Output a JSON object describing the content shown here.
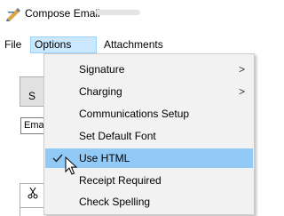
{
  "window": {
    "title": "Compose Email",
    "icon": "compose-email-icon"
  },
  "menubar": {
    "file": "File",
    "options": "Options",
    "attachments": "Attachments"
  },
  "background": {
    "button_fragment": "S",
    "combo_fragment": "Ema",
    "cut_icon": "scissors-icon"
  },
  "options_menu": {
    "items": [
      {
        "label": "Signature",
        "submenu": true,
        "arrow": ">"
      },
      {
        "label": "Charging",
        "submenu": true,
        "arrow": ">"
      },
      {
        "label": "Communications Setup"
      },
      {
        "label": "Set Default Font"
      },
      {
        "label": "Use HTML",
        "checked": true,
        "highlighted": true
      },
      {
        "label": "Receipt Required"
      },
      {
        "label": "Check Spelling"
      }
    ]
  },
  "colors": {
    "menu_highlight": "#91c9f7",
    "menubar_active": "#cce8ff",
    "menu_background": "#f2f2f2"
  }
}
